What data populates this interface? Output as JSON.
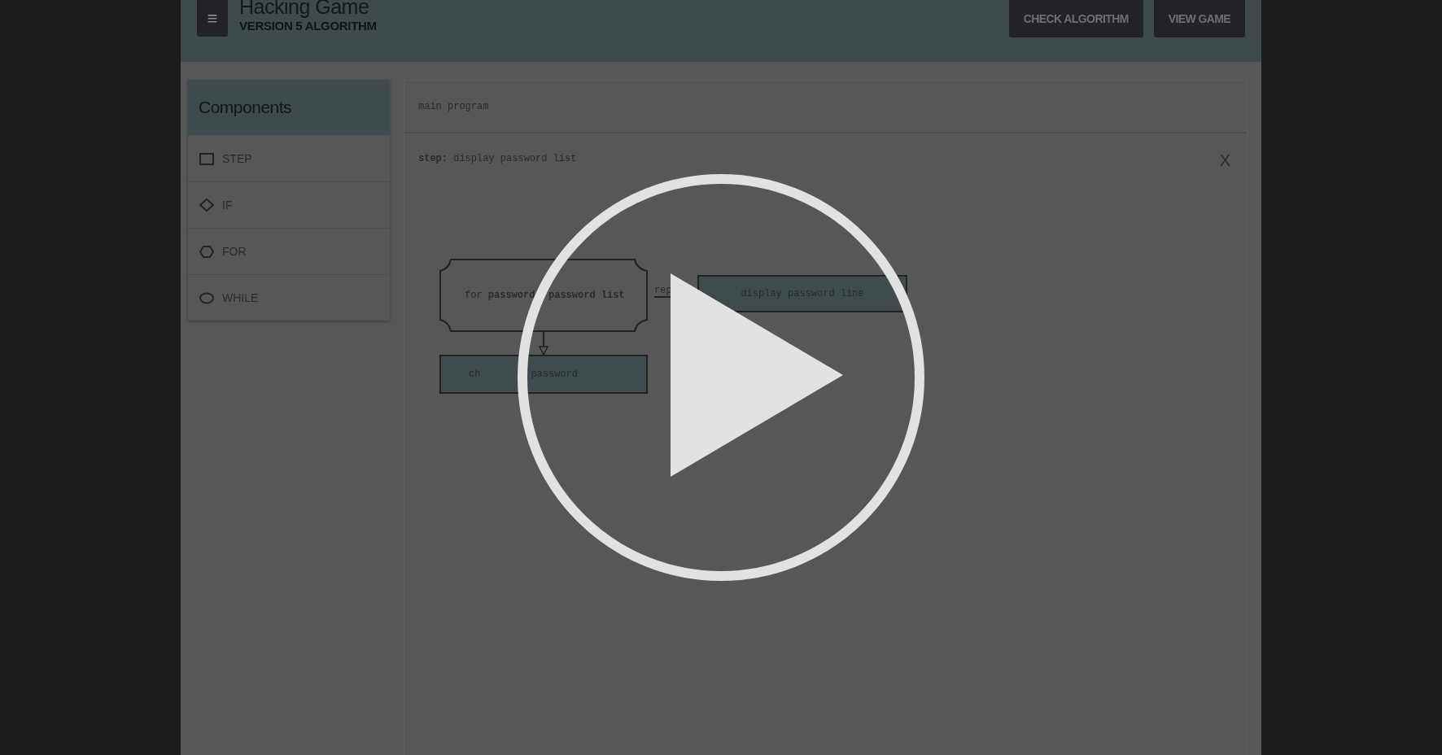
{
  "header": {
    "menu_icon": "≡",
    "title": "Hacking Game",
    "subtitle": "VERSION 5 ALGORITHM",
    "buttons": [
      "CHECK ALGORITHM",
      "VIEW GAME"
    ]
  },
  "sidebar": {
    "title": "Components",
    "items": [
      {
        "kind": "step",
        "label": "STEP"
      },
      {
        "kind": "if",
        "label": "IF"
      },
      {
        "kind": "for",
        "label": "FOR"
      },
      {
        "kind": "while",
        "label": "WHILE"
      }
    ]
  },
  "main": {
    "program_label": "main program",
    "step_text": "**step:** display password list",
    "close": "X",
    "diagram": {
      "for_parts": [
        "for **password**",
        "**password list**"
      ],
      "repeat_label": "rep",
      "display_box": "display password line",
      "choose_parts": [
        "ch",
        "password"
      ]
    }
  }
}
